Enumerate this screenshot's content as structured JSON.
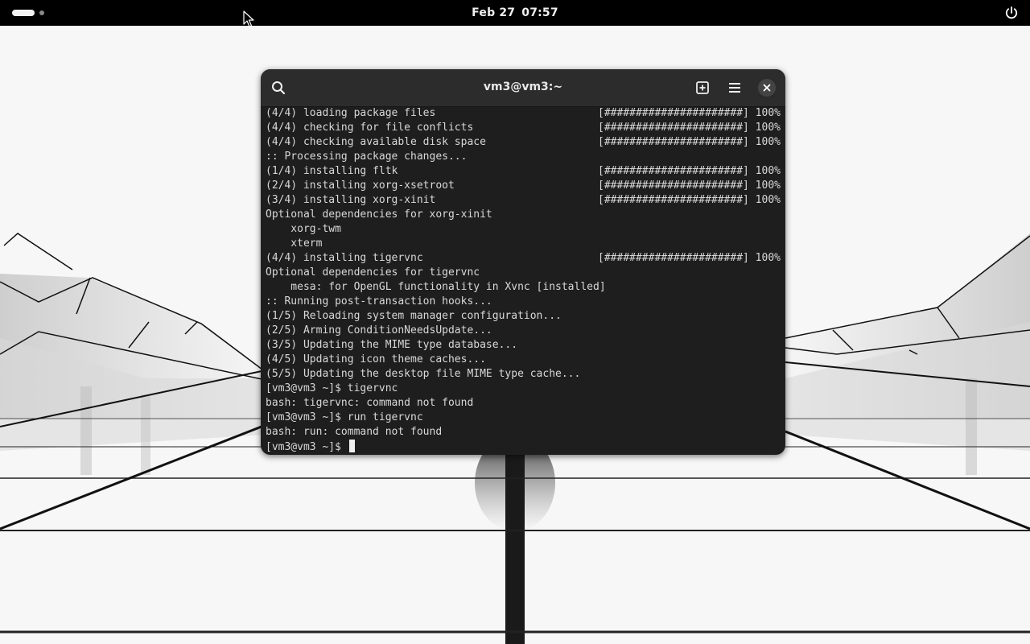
{
  "topbar": {
    "date": "Feb 27",
    "time": "07:57",
    "icons": {
      "activities": "workspace-indicator-icon",
      "power": "power-icon"
    }
  },
  "terminal": {
    "title": "vm3@vm3:~",
    "icons": {
      "search": "search-icon",
      "new_tab": "new-tab-icon",
      "menu": "hamburger-menu-icon",
      "close": "close-icon"
    },
    "lines": [
      {
        "text": "(4/4) loading package files",
        "progress": "[######################] 100%"
      },
      {
        "text": "(4/4) checking for file conflicts",
        "progress": "[######################] 100%"
      },
      {
        "text": "(4/4) checking available disk space",
        "progress": "[######################] 100%"
      },
      {
        "text": ":: Processing package changes...",
        "progress": ""
      },
      {
        "text": "(1/4) installing fltk",
        "progress": "[######################] 100%"
      },
      {
        "text": "(2/4) installing xorg-xsetroot",
        "progress": "[######################] 100%"
      },
      {
        "text": "(3/4) installing xorg-xinit",
        "progress": "[######################] 100%"
      },
      {
        "text": "Optional dependencies for xorg-xinit",
        "progress": ""
      },
      {
        "text": "    xorg-twm",
        "progress": ""
      },
      {
        "text": "    xterm",
        "progress": ""
      },
      {
        "text": "(4/4) installing tigervnc",
        "progress": "[######################] 100%"
      },
      {
        "text": "Optional dependencies for tigervnc",
        "progress": ""
      },
      {
        "text": "    mesa: for OpenGL functionality in Xvnc [installed]",
        "progress": ""
      },
      {
        "text": ":: Running post-transaction hooks...",
        "progress": ""
      },
      {
        "text": "(1/5) Reloading system manager configuration...",
        "progress": ""
      },
      {
        "text": "(2/5) Arming ConditionNeedsUpdate...",
        "progress": ""
      },
      {
        "text": "(3/5) Updating the MIME type database...",
        "progress": ""
      },
      {
        "text": "(4/5) Updating icon theme caches...",
        "progress": ""
      },
      {
        "text": "(5/5) Updating the desktop file MIME type cache...",
        "progress": ""
      },
      {
        "text": "[vm3@vm3 ~]$ tigervnc",
        "progress": ""
      },
      {
        "text": "bash: tigervnc: command not found",
        "progress": ""
      },
      {
        "text": "[vm3@vm3 ~]$ run tigervnc",
        "progress": ""
      },
      {
        "text": "bash: run: command not found",
        "progress": ""
      },
      {
        "text": "[vm3@vm3 ~]$ ",
        "progress": "",
        "cursor": true
      }
    ]
  },
  "colors": {
    "topbar_bg": "#000000",
    "terminal_bg": "#1e1e1e",
    "headerbar_bg": "#2c2c2c",
    "terminal_text": "#d8d8d8"
  }
}
